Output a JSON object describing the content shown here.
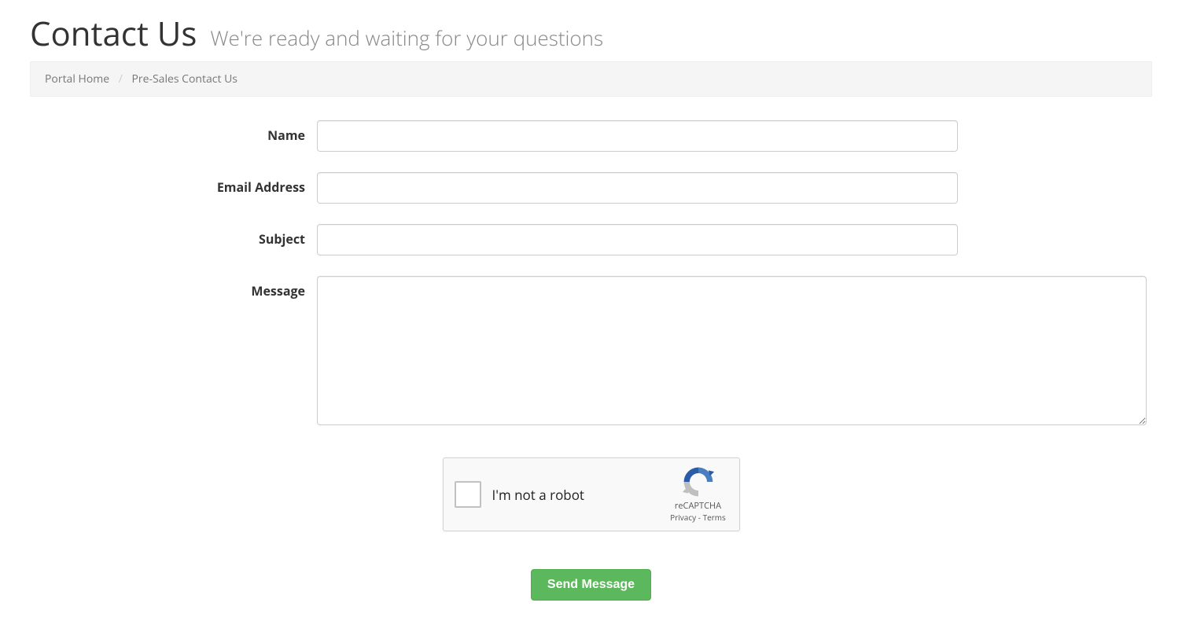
{
  "header": {
    "title": "Contact Us",
    "subtitle": "We're ready and waiting for your questions"
  },
  "breadcrumb": {
    "home": "Portal Home",
    "separator": "/",
    "current": "Pre-Sales Contact Us"
  },
  "form": {
    "name": {
      "label": "Name",
      "value": ""
    },
    "email": {
      "label": "Email Address",
      "value": ""
    },
    "subject": {
      "label": "Subject",
      "value": ""
    },
    "message": {
      "label": "Message",
      "value": ""
    }
  },
  "captcha": {
    "label": "I'm not a robot",
    "brand": "reCAPTCHA",
    "privacy": "Privacy",
    "separator": " - ",
    "terms": "Terms"
  },
  "submit": {
    "label": "Send Message"
  }
}
